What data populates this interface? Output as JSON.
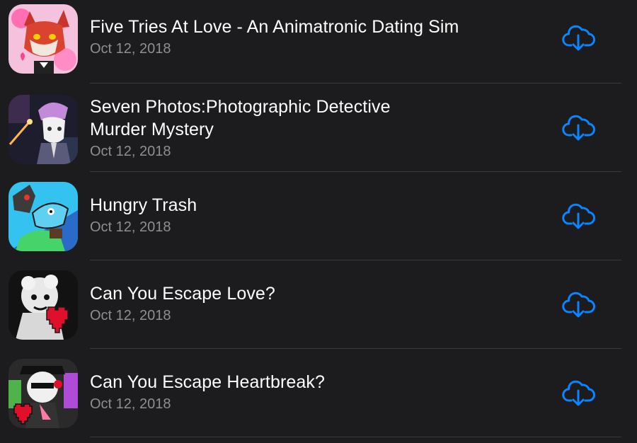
{
  "theme": {
    "background": "#1c1c1e",
    "title_color": "#ffffff",
    "date_color": "#8e8e93",
    "accent": "#0a84ff",
    "separator": "#3a3a3c"
  },
  "apps": [
    {
      "title": "Five Tries At Love - An Animatronic Dating Sim",
      "date": "Oct 12, 2018",
      "icon": "fox-character-icon",
      "action_icon": "cloud-download-icon"
    },
    {
      "title": "Seven Photos:Photographic Detective Murder Mystery",
      "date": "Oct 12, 2018",
      "icon": "detective-character-icon",
      "action_icon": "cloud-download-icon"
    },
    {
      "title": "Hungry Trash",
      "date": "Oct 12, 2018",
      "icon": "trash-monster-icon",
      "action_icon": "cloud-download-icon"
    },
    {
      "title": "Can You Escape Love?",
      "date": "Oct 12, 2018",
      "icon": "sheep-heart-icon",
      "action_icon": "cloud-download-icon"
    },
    {
      "title": "Can You Escape Heartbreak?",
      "date": "Oct 12, 2018",
      "icon": "sheep-broken-heart-icon",
      "action_icon": "cloud-download-icon"
    }
  ]
}
